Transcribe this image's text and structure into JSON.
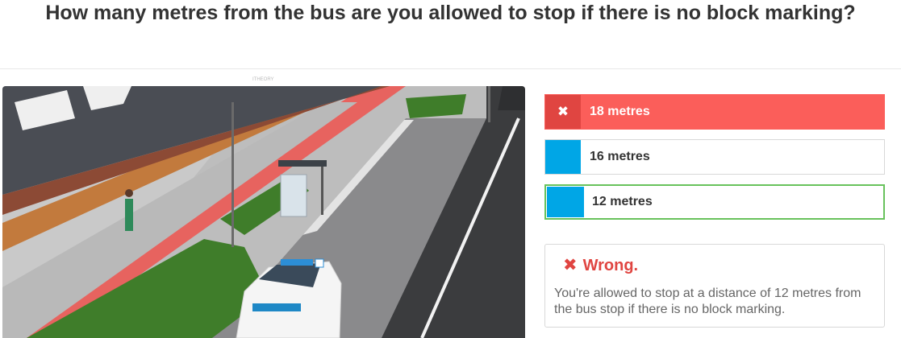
{
  "question": "How many metres from the bus are you allowed to stop if there is no block marking?",
  "watermark": "ITHEORY",
  "answers": [
    {
      "label": "18 metres",
      "state": "wrong",
      "icon": "close-icon"
    },
    {
      "label": "16 metres",
      "state": "normal"
    },
    {
      "label": "12 metres",
      "state": "correct"
    }
  ],
  "feedback": {
    "icon": "close-icon",
    "title": "Wrong.",
    "text": "You're allowed to stop at a distance of 12 metres from the bus stop if there is no block marking."
  },
  "colors": {
    "wrong": "#fb5e5a",
    "wrong_dark": "#e04541",
    "answer_tag": "#00a6e6",
    "correct_border": "#68c25c"
  }
}
